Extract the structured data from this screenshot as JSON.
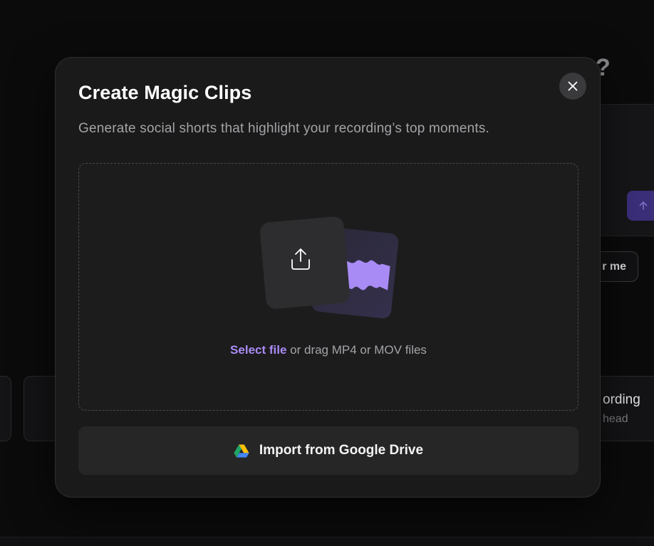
{
  "modal": {
    "title": "Create Magic Clips",
    "subtitle": "Generate social shorts that highlight your recording’s top moments.",
    "close_icon": "close-icon",
    "dropzone": {
      "select_label": "Select file",
      "drag_label": " or drag MP4 or MOV files",
      "upload_icon": "upload-icon",
      "waveform_icon": "audio-waveform-icon"
    },
    "import_button": {
      "label": "Import from Google Drive",
      "icon": "google-drive-icon"
    }
  },
  "background": {
    "help_glyph": "?",
    "pill_label": "r me",
    "card_right_title": "ording",
    "card_right_sub": "head"
  },
  "colors": {
    "accent": "#a98bf5",
    "modal_bg": "#1a1a1b",
    "page_bg": "#0b0b0c"
  }
}
